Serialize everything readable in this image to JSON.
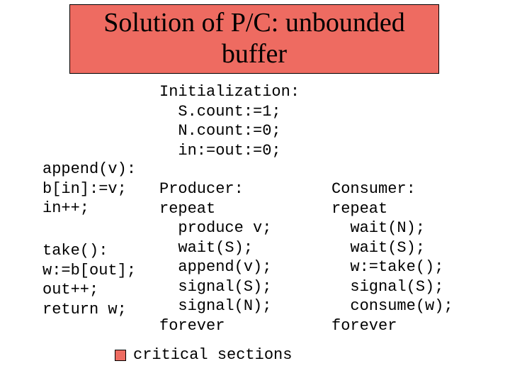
{
  "title": "Solution of P/C: unbounded buffer",
  "init": "Initialization:\n  S.count:=1;\n  N.count:=0;\n  in:=out:=0;",
  "append_fn": "append(v):\nb[in]:=v;\nin++;",
  "take_fn": "take():\nw:=b[out];\nout++;\nreturn w;",
  "producer": "Producer:\nrepeat\n  produce v;\n  wait(S);\n  append(v);\n  signal(S);\n  signal(N);\nforever",
  "consumer": "Consumer:\nrepeat\n  wait(N);\n  wait(S);\n  w:=take();\n  signal(S);\n  consume(w);\nforever",
  "legend": "critical sections"
}
